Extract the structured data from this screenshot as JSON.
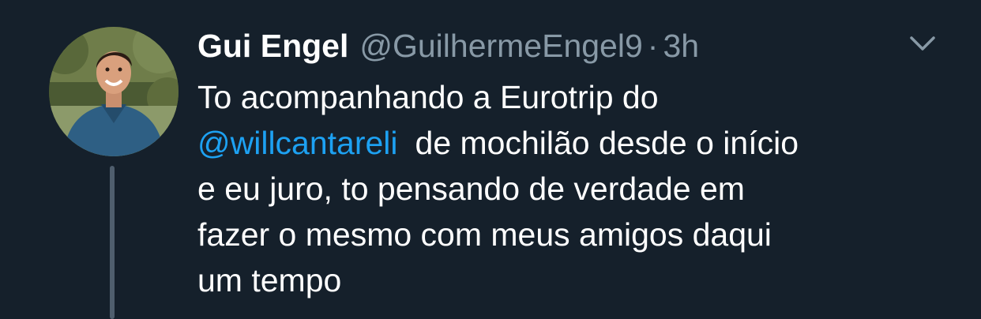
{
  "tweet": {
    "display_name": "Gui Engel",
    "handle": "@GuilhermeEngel9",
    "separator": "·",
    "time": "3h",
    "text_lines": {
      "line1": "To acompanhando a Eurotrip do",
      "line2_mention": "@willcantareli",
      "line2_rest": "de mochilão desde o início",
      "line3": "e eu juro, to pensando de verdade em",
      "line4": "fazer o mesmo com meus amigos daqui",
      "line5": "um tempo"
    }
  },
  "colors": {
    "background": "#15202b",
    "text_primary": "#ffffff",
    "text_secondary": "#8899a6",
    "link": "#1da1f2",
    "thread_line": "#4f5e6d"
  },
  "icons": {
    "menu": "chevron-down-icon",
    "avatar": "user-avatar"
  }
}
